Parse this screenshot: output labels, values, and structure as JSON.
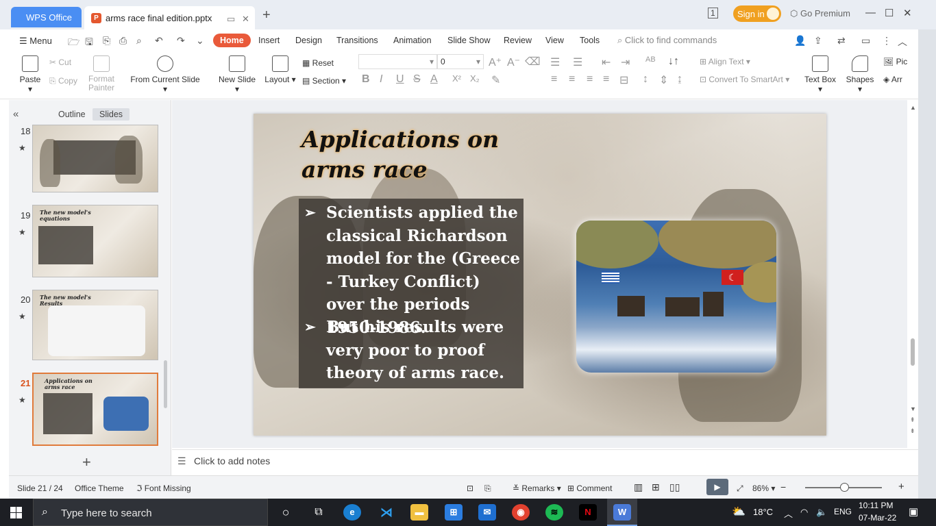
{
  "titlebar": {
    "app_tab": "WPS Office",
    "doc_tab": "arms race final edition.pptx",
    "doc_badge": "P",
    "sign_in": "Sign in",
    "go_premium": "Go Premium"
  },
  "menu": {
    "menu_label": "Menu",
    "tabs": [
      "Home",
      "Insert",
      "Design",
      "Transitions",
      "Animation",
      "Slide Show",
      "Review",
      "View",
      "Tools"
    ],
    "active_tab": "Home",
    "find_placeholder": "Click to find commands"
  },
  "ribbon": {
    "paste": "Paste",
    "cut": "Cut",
    "copy": "Copy",
    "format_painter_1": "Format",
    "format_painter_2": "Painter",
    "from_current_slide": "From Current Slide",
    "new_slide": "New Slide",
    "layout": "Layout",
    "reset": "Reset",
    "section": "Section",
    "font_size_value": "0",
    "align_text": "Align Text",
    "convert_smartart": "Convert To SmartArt",
    "text_box": "Text Box",
    "shapes": "Shapes",
    "picture": "Pic",
    "arrange": "Arr"
  },
  "left_panel": {
    "tab_outline": "Outline",
    "tab_slides": "Slides",
    "thumbnails": [
      {
        "num": "18",
        "title": ""
      },
      {
        "num": "19",
        "title": "The new model's equations"
      },
      {
        "num": "20",
        "title": "The new model's Results"
      },
      {
        "num": "21",
        "title": "Applications on arms race"
      }
    ]
  },
  "slide": {
    "title": "Applications on arms race",
    "bullets": [
      "Scientists applied the classical Richardson model for the (Greece - Turkey Conflict) over the periods 1950-1986.",
      " But his results were very poor to proof theory of arms race."
    ],
    "bullet_marker": "➢"
  },
  "notes": {
    "placeholder": "Click to add notes"
  },
  "statusbar": {
    "slide_counter": "Slide 21 / 24",
    "theme": "Office Theme",
    "font_missing": "Font Missing",
    "remarks": "Remarks",
    "comment": "Comment",
    "zoom": "86%"
  },
  "taskbar": {
    "search_placeholder": "Type here to search",
    "temperature": "18°C",
    "language": "ENG",
    "time": "10:11 PM",
    "date": "07-Mar-22"
  }
}
